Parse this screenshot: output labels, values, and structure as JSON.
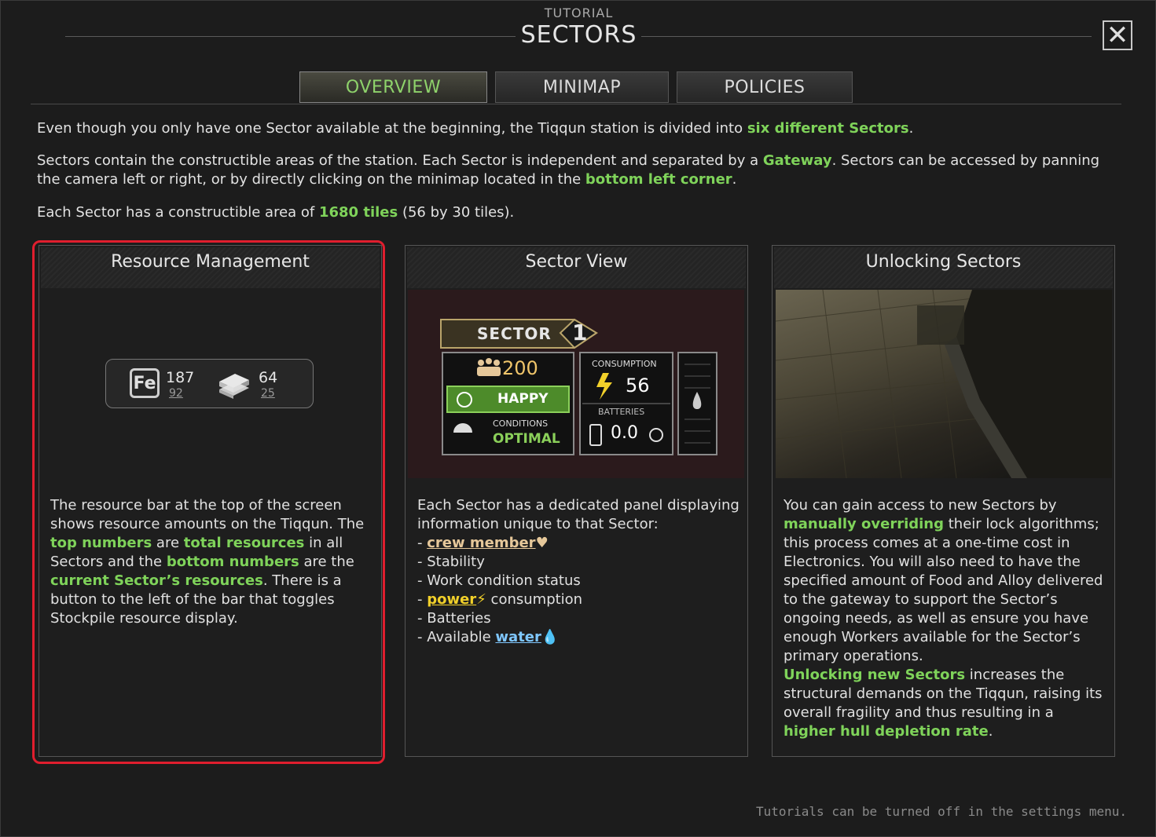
{
  "header": {
    "subtitle": "Tutorial",
    "title": "SECTORS",
    "close_glyph": "✕"
  },
  "tabs": [
    {
      "label": "OVERVIEW",
      "active": true
    },
    {
      "label": "MINIMAP",
      "active": false
    },
    {
      "label": "POLICIES",
      "active": false
    }
  ],
  "intro": {
    "p1_a": "Even though you only have one Sector available at the beginning, the Tiqqun station is divided into ",
    "p1_b": "six different Sectors",
    "p1_c": ".",
    "p2_a": "Sectors contain the constructible areas of the station. Each Sector is independent and separated by a ",
    "p2_b": "Gateway",
    "p2_c": ". Sectors can be accessed by panning the camera left or right, or by directly clicking on the minimap located in the ",
    "p2_d": "bottom left corner",
    "p2_e": ".",
    "p3_a": "Each Sector has a constructible area of ",
    "p3_b": "1680 tiles",
    "p3_c": " (56 by 30 tiles)."
  },
  "cards": {
    "resource": {
      "title": "Resource Management",
      "fe_label": "Fe",
      "fe_top": "187",
      "fe_bottom": "92",
      "alloy_top": "64",
      "alloy_bottom": "25",
      "b1": "The resource bar at the top of the screen shows resource amounts on the Tiqqun. The ",
      "b2": "top numbers",
      "b3": " are ",
      "b4": "total resources",
      "b5": " in all Sectors and the ",
      "b6": "bottom numbers",
      "b7": " are the ",
      "b8": "current Sector’s resources",
      "b9": ". There is a button to the left of the bar that toggles Stockpile resource display."
    },
    "sector_view": {
      "title": "Sector View",
      "sector_label": "SECTOR",
      "sector_num": "1",
      "crew": "200",
      "mood": "HAPPY",
      "conditions_label": "CONDITIONS",
      "conditions_value": "OPTIMAL",
      "consumption_label": "CONSUMPTION",
      "consumption_value": "56",
      "batteries_label": "BATTERIES",
      "batteries_value": "0.0",
      "intro": "Each Sector has a dedicated panel displaying information unique to that Sector:",
      "li_dash": "- ",
      "li1": "crew member",
      "li2": "- Stability",
      "li3": "- Work condition status",
      "li4a": "power",
      "li4b": " consumption",
      "li5": "- Batteries",
      "li6a": "- Available ",
      "li6b": "water"
    },
    "unlocking": {
      "title": "Unlocking Sectors",
      "t1": "You can gain access to new Sectors by ",
      "t2": "manually overriding",
      "t3": " their lock algorithms; this process comes at a one-time cost in Electronics. You will also need to have the specified amount of Food and Alloy delivered to the gateway to support the Sector’s ongoing needs, as well as ensure you have enough Workers available for the Sector’s primary operations.",
      "t4": "Unlocking new Sectors",
      "t5": " increases the structural demands on the Tiqqun, raising its overall fragility and thus resulting in a ",
      "t6": "higher hull depletion rate",
      "t7": "."
    }
  },
  "footer": "Tutorials can be turned off in the settings menu.",
  "colors": {
    "accent_green": "#7fd35a",
    "highlight_red": "#e01e2e",
    "power_yellow": "#f1d02a",
    "water_blue": "#7fc7ff"
  }
}
